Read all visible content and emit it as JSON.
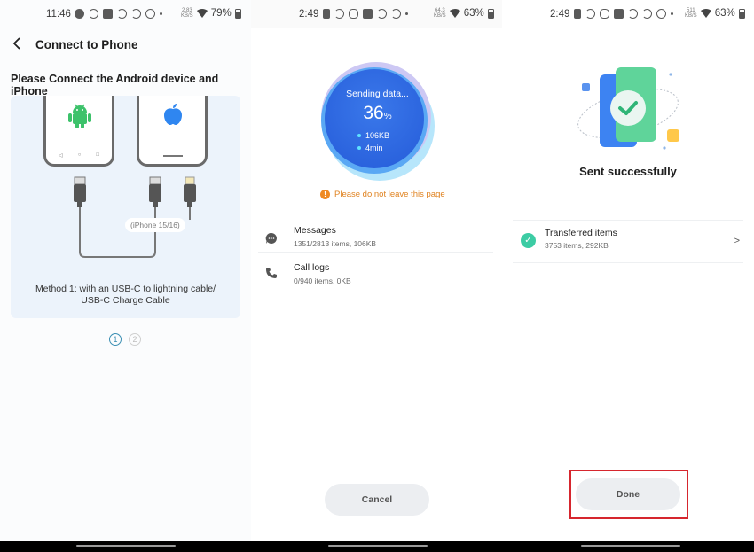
{
  "screens": [
    {
      "status": {
        "time": "11:46",
        "net_speed": "2.83\nKB/S",
        "battery": "79%"
      },
      "header": {
        "back_icon": "chevron-left-icon",
        "title": "Connect to Phone"
      },
      "heading": "Please Connect the Android device and iPhone",
      "illustration": {
        "android_icon": "android-logo-icon",
        "apple_icon": "apple-logo-icon",
        "cable_chip": "(iPhone 15/16)"
      },
      "method_line1": "Method 1: with an USB-C to lightning cable/",
      "method_line2": "USB-C Charge Cable",
      "pager": {
        "pages": [
          "1",
          "2"
        ],
        "active": 1
      }
    },
    {
      "status": {
        "time": "2:49",
        "net_speed": "64.3\nKB/S",
        "battery": "63%"
      },
      "progress": {
        "label": "Sending data...",
        "percent": 36,
        "percent_number": "36",
        "percent_sign": "%",
        "size": "106KB",
        "time_left": "4min"
      },
      "warning": "Please do not leave this page",
      "items": [
        {
          "icon": "message-bubble-icon",
          "label": "Messages",
          "detail": "1351/2813 items, 106KB"
        },
        {
          "icon": "phone-icon",
          "label": "Call logs",
          "detail": "0/940 items, 0KB"
        }
      ],
      "cancel_label": "Cancel"
    },
    {
      "status": {
        "time": "2:49",
        "net_speed": "511\nKB/S",
        "battery": "63%"
      },
      "result": "Sent successfully",
      "summary": {
        "icon": "check-circle-icon",
        "label": "Transferred items",
        "detail": "3753 items, 292KB",
        "chevron": ">"
      },
      "done_label": "Done"
    }
  ],
  "colors": {
    "accent_blue": "#3d7ff0",
    "success_green": "#3ccca4",
    "warning_orange": "#e08321",
    "highlight_red": "#d6262e"
  }
}
